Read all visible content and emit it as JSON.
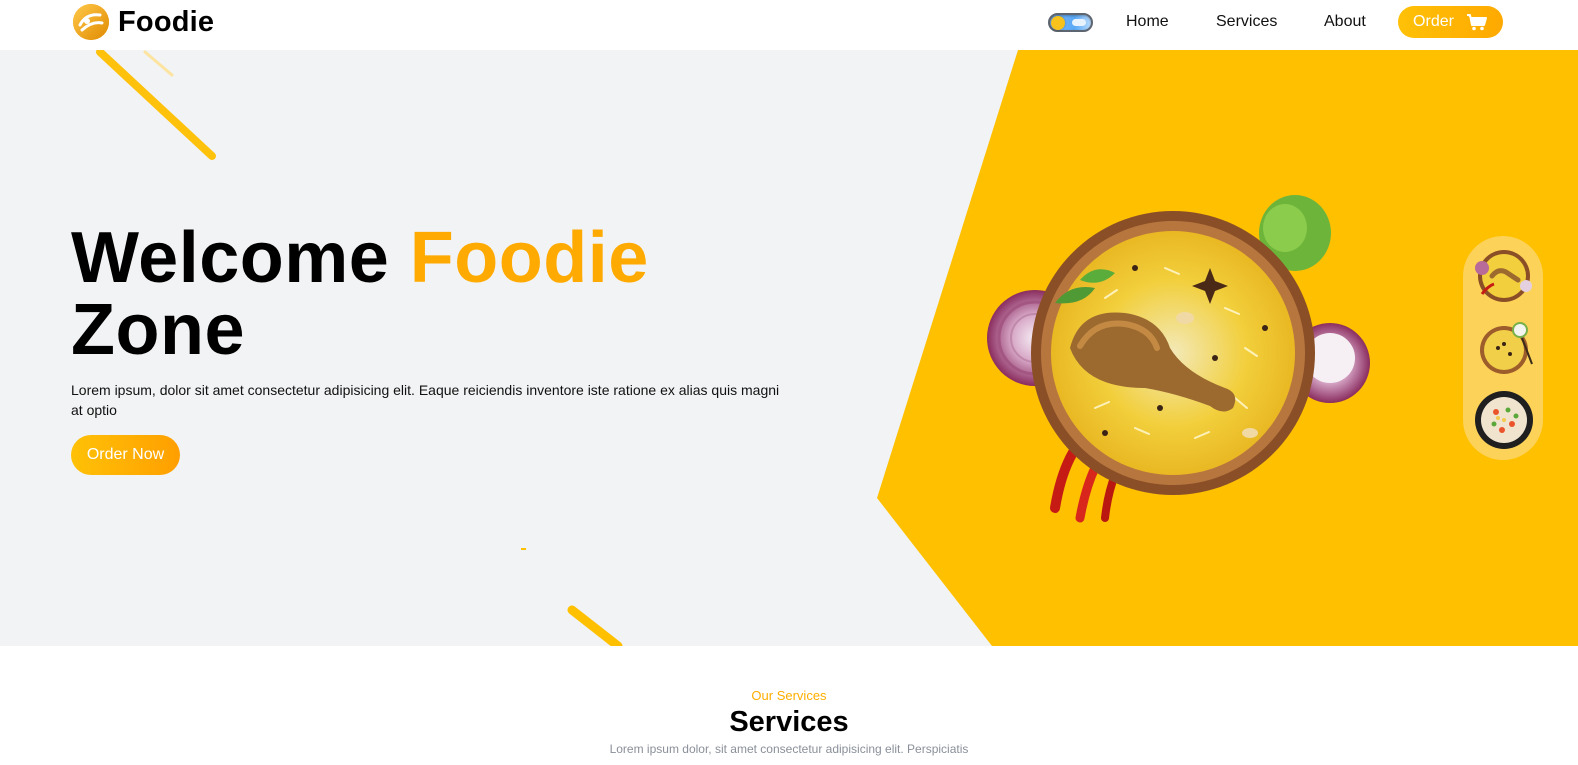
{
  "brand": {
    "name": "Foodie",
    "logo_icon": "foodie-logo-icon"
  },
  "nav": {
    "theme_toggle_icon": "theme-toggle-icon",
    "links": [
      "Home",
      "Services",
      "About"
    ],
    "order_label": "Order",
    "order_icon": "cart-icon"
  },
  "hero": {
    "title_part1": "Welcome ",
    "title_accent": "Foodie",
    "title_part2": "Zone",
    "description": "Lorem ipsum, dolor sit amet consectetur adipisicing elit. Eaque reiciendis inventore iste ratione ex alias quis magni at optio",
    "cta_label": "Order Now",
    "main_image": "biryani-plate-image",
    "thumbnails": [
      "biryani-thumb-1",
      "biryani-thumb-2",
      "fried-rice-thumb-3"
    ]
  },
  "services": {
    "eyebrow": "Our Services",
    "title": "Services",
    "subtitle": "Lorem ipsum dolor, sit amet consectetur adipisicing elit. Perspiciatis"
  },
  "colors": {
    "accent": "#ffaa00",
    "hero_yellow": "#ffc107",
    "hero_bg": "#f2f3f5",
    "slider_bg": "#fcd258"
  }
}
